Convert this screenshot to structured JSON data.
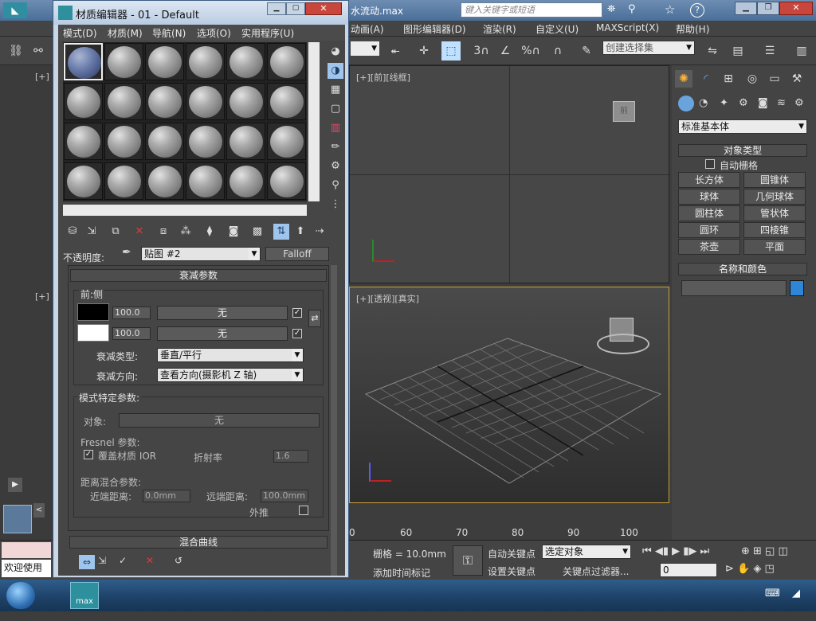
{
  "app": {
    "title_file": "水流动.max",
    "search_placeholder": "键入关键字或短语",
    "menu": [
      "动画(A)",
      "图形编辑器(D)",
      "渲染(R)",
      "自定义(U)",
      "MAXScript(X)",
      "帮助(H)"
    ],
    "selection_set_placeholder": "创建选择集"
  },
  "viewports": {
    "top_left_label": "[+]",
    "front_label": "[+][前][线框]",
    "left_label": "[+]",
    "persp_label": "[+][透视][真实]",
    "viewcube_top": "前"
  },
  "cmd_panel": {
    "category_dropdown": "标准基本体",
    "object_type_title": "对象类型",
    "auto_grid": "自动栅格",
    "buttons": [
      "长方体",
      "圆锥体",
      "球体",
      "几何球体",
      "圆柱体",
      "管状体",
      "圆环",
      "四棱锥",
      "茶壶",
      "平面"
    ],
    "name_color_title": "名称和颜色"
  },
  "bottom": {
    "welcome": "欢迎使用",
    "grid": "栅格 = 10.0mm",
    "add_time_tag": "添加时间标记",
    "auto_key": "自动关键点",
    "set_key": "设置关键点",
    "selected_obj": "选定对象",
    "key_filters": "关键点过滤器...",
    "frame": "0",
    "ruler": [
      "0",
      "60",
      "70",
      "80",
      "90",
      "100"
    ]
  },
  "taskbar": {
    "max_label": "max"
  },
  "material_editor": {
    "title": "材质编辑器 - 01 - Default",
    "menu": [
      "模式(D)",
      "材质(M)",
      "导航(N)",
      "选项(O)",
      "实用程序(U)"
    ],
    "opacity_label": "不透明度:",
    "map_name": "贴图 #2",
    "map_type": "Falloff",
    "rollout_falloff": "衰减参数",
    "front_side": "前:侧",
    "row1": {
      "value": "100.0",
      "map": "无"
    },
    "row2": {
      "value": "100.0",
      "map": "无"
    },
    "falloff_type_label": "衰减类型:",
    "falloff_type_value": "垂直/平行",
    "falloff_dir_label": "衰减方向:",
    "falloff_dir_value": "查看方向(摄影机 Z 轴)",
    "mode_params": "模式特定参数:",
    "object_label": "对象:",
    "object_value": "无",
    "fresnel_title": "Fresnel 参数:",
    "override_ior": "覆盖材质 IOR",
    "ior_label": "折射率",
    "ior_value": "1.6",
    "distance_title": "距离混合参数:",
    "near_label": "近端距离:",
    "near_value": "0.0mm",
    "far_label": "远端距离:",
    "far_value": "100.0mm",
    "extrapolate": "外推",
    "rollout_curve": "混合曲线"
  }
}
